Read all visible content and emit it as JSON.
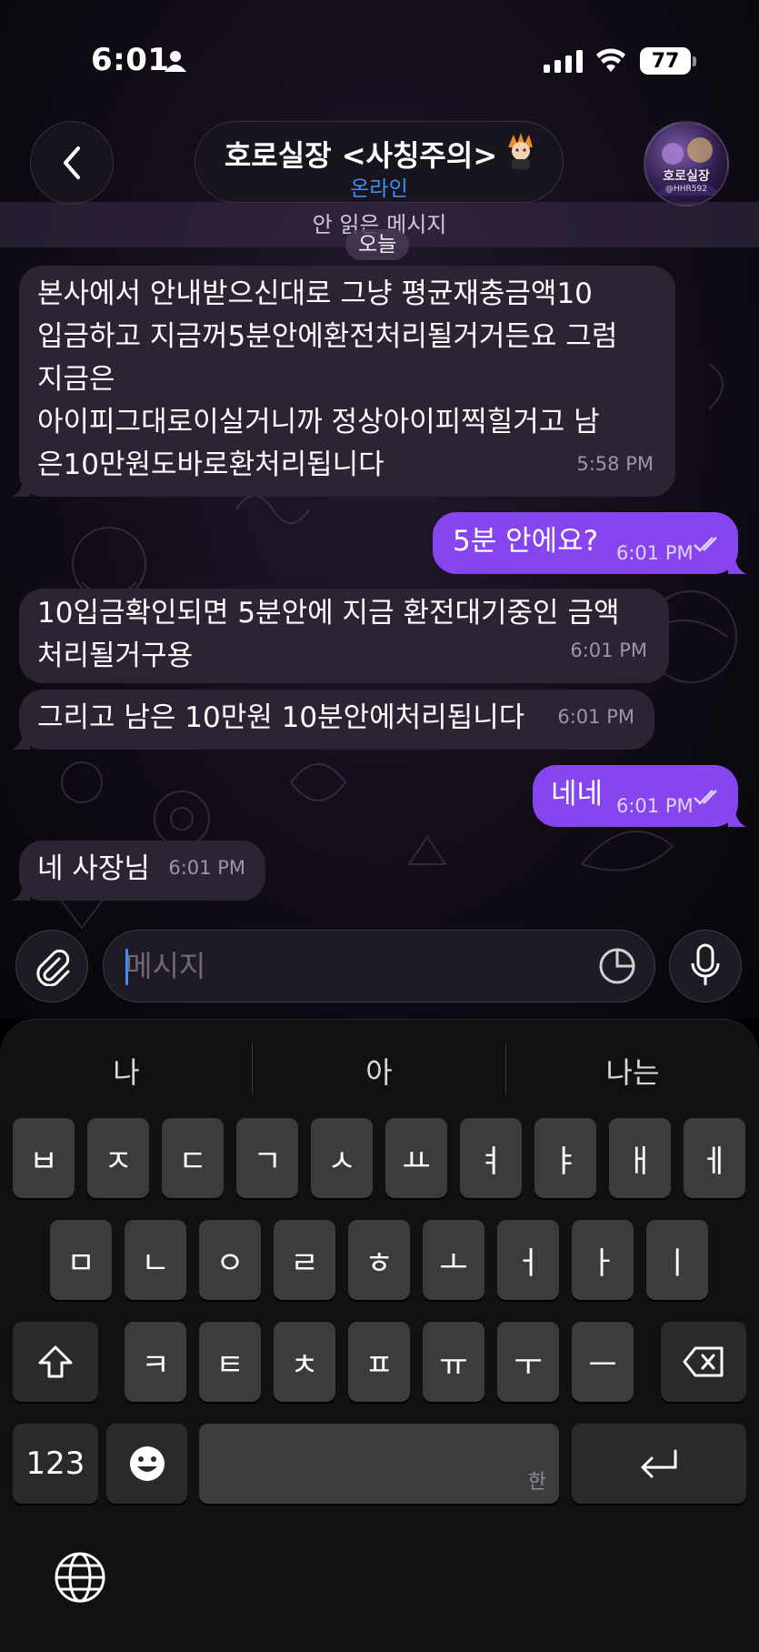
{
  "status_bar": {
    "time": "6:01",
    "battery": "77"
  },
  "header": {
    "contact_name": "호로실장 <사칭주의>",
    "status": "온라인",
    "avatar_text": "호로실장",
    "avatar_sub": "@HHR592",
    "back_icon": "chevron-left-icon",
    "emoji_icon": "character-sticker-icon"
  },
  "unread_label": "안 읽은 메시지",
  "date_chip": "오늘",
  "messages": [
    {
      "dir": "in",
      "text": "본사에서 안내받으신대로 그냥 평균재충금액10\n입금하고 지금꺼5분안에환전처리될거거든요 그럼\n지금은\n아이피그대로이실거니까 정상아이피찍힐거고 남\n은10만원도바로환처리됩니다",
      "time": "5:58 PM"
    },
    {
      "dir": "out",
      "text": "5분 안에요?",
      "time": "6:01 PM"
    },
    {
      "dir": "in",
      "text": "10입금확인되면 5분안에 지금 환전대기중인 금액\n처리될거구용",
      "time": "6:01 PM"
    },
    {
      "dir": "in",
      "text": "그리고 남은 10만원 10분안에처리됩니다",
      "time": "6:01 PM"
    },
    {
      "dir": "out",
      "text": "네네",
      "time": "6:01 PM"
    },
    {
      "dir": "in",
      "text": "네 사장님",
      "time": "6:01 PM"
    }
  ],
  "composer": {
    "placeholder": "메시지",
    "attach_icon": "paperclip-icon",
    "sticker_icon": "sticker-icon",
    "mic_icon": "microphone-icon"
  },
  "keyboard": {
    "suggestions": [
      "나",
      "아",
      "나는"
    ],
    "row1": [
      "ㅂ",
      "ㅈ",
      "ㄷ",
      "ㄱ",
      "ㅅ",
      "ㅛ",
      "ㅕ",
      "ㅑ",
      "ㅐ",
      "ㅔ"
    ],
    "row2": [
      "ㅁ",
      "ㄴ",
      "ㅇ",
      "ㄹ",
      "ㅎ",
      "ㅗ",
      "ㅓ",
      "ㅏ",
      "ㅣ"
    ],
    "row3": [
      "ㅋ",
      "ㅌ",
      "ㅊ",
      "ㅍ",
      "ㅠ",
      "ㅜ",
      "ㅡ"
    ],
    "numbers_label": "123",
    "space_hint": "한",
    "shift_icon": "shift-icon",
    "backspace_icon": "backspace-icon",
    "emoji_icon": "emoji-icon",
    "return_icon": "return-icon",
    "globe_icon": "globe-icon"
  },
  "colors": {
    "outgoing_bubble": "#8645ee",
    "incoming_bubble": "#2c2333",
    "online_status": "#3f8ef2"
  }
}
